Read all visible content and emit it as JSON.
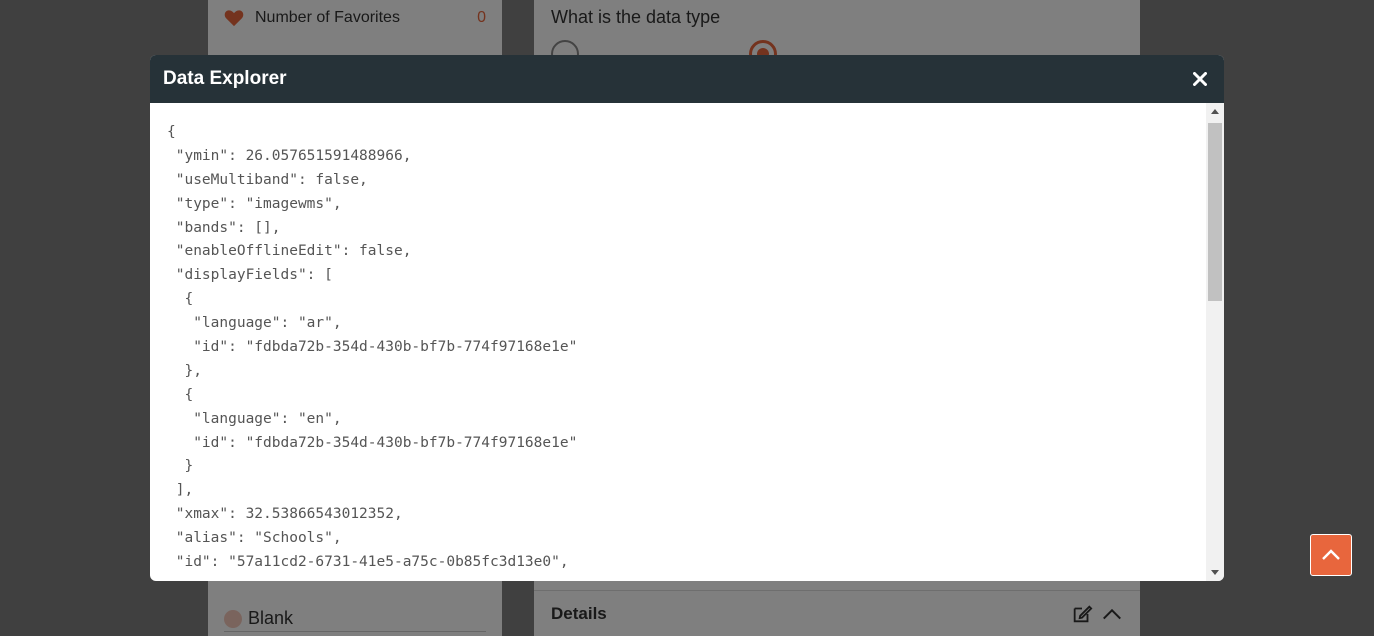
{
  "background": {
    "favorites_label": "Number of Favorites",
    "favorites_count": "0",
    "question": "What is the data type",
    "blank_label": "Blank",
    "details_title": "Details"
  },
  "modal": {
    "title": "Data Explorer",
    "json_lines": [
      "{",
      " \"ymin\": 26.057651591488966,",
      " \"useMultiband\": false,",
      " \"type\": \"imagewms\",",
      " \"bands\": [],",
      " \"enableOfflineEdit\": false,",
      " \"displayFields\": [",
      "  {",
      "   \"language\": \"ar\",",
      "   \"id\": \"fdbda72b-354d-430b-bf7b-774f97168e1e\"",
      "  },",
      "  {",
      "   \"language\": \"en\",",
      "   \"id\": \"fdbda72b-354d-430b-bf7b-774f97168e1e\"",
      "  }",
      " ],",
      " \"xmax\": 32.53866543012352,",
      " \"alias\": \"Schools\",",
      " \"id\": \"57a11cd2-6731-41e5-a75c-0b85fc3d13e0\","
    ]
  },
  "colors": {
    "accent": "#e8663d",
    "header_bg": "#263238"
  }
}
